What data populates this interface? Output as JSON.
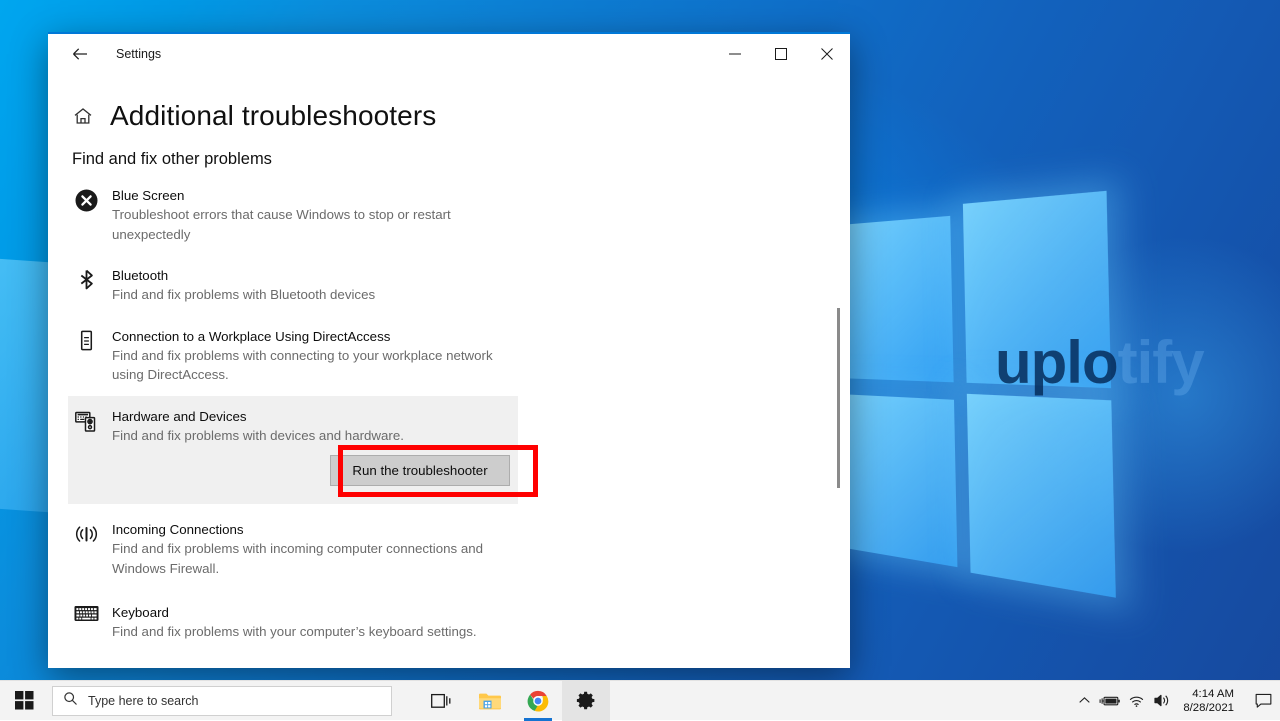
{
  "window": {
    "app_title": "Settings",
    "back_icon": "back-arrow-icon",
    "minimize_label": "—",
    "maximize_label": "□",
    "close_label": "✕",
    "page_title": "Additional troubleshooters",
    "home_icon": "home-icon",
    "section_title": "Find and fix other problems",
    "accent_color": "#0078d7",
    "selected_row_color": "#f0f0f0",
    "annotation_color": "#ff0000"
  },
  "troubleshooters": [
    {
      "icon": "blue-screen-icon",
      "title": "Blue Screen",
      "description": "Troubleshoot errors that cause Windows to stop or restart unexpectedly",
      "selected": false
    },
    {
      "icon": "bluetooth-icon",
      "title": "Bluetooth",
      "description": "Find and fix problems with Bluetooth devices",
      "selected": false
    },
    {
      "icon": "workplace-connection-icon",
      "title": "Connection to a Workplace Using DirectAccess",
      "description": "Find and fix problems with connecting to your workplace network using DirectAccess.",
      "selected": false
    },
    {
      "icon": "hardware-devices-icon",
      "title": "Hardware and Devices",
      "description": "Find and fix problems with devices and hardware.",
      "selected": true,
      "action_label": "Run the troubleshooter"
    },
    {
      "icon": "incoming-connections-icon",
      "title": "Incoming Connections",
      "description": "Find and fix problems with incoming computer connections and Windows Firewall.",
      "selected": false
    },
    {
      "icon": "keyboard-icon",
      "title": "Keyboard",
      "description": "Find and fix problems with your computer’s keyboard settings.",
      "selected": false
    }
  ],
  "desktop": {
    "watermark_primary": "uplo",
    "watermark_secondary": "tify"
  },
  "taskbar": {
    "start_icon": "windows-start-icon",
    "search_placeholder": "Type here to search",
    "search_icon": "search-icon",
    "icons": [
      {
        "name": "task-view-icon",
        "active": false,
        "highlight": false
      },
      {
        "name": "file-explorer-icon",
        "active": false,
        "highlight": false
      },
      {
        "name": "google-chrome-icon",
        "active": true,
        "highlight": false
      },
      {
        "name": "settings-gear-icon",
        "active": false,
        "highlight": true
      }
    ],
    "tray": {
      "chevron_up_icon": "show-hidden-icons-icon",
      "battery_icon": "battery-charging-icon",
      "network_icon": "wifi-icon",
      "volume_icon": "speaker-icon",
      "time": "4:14 AM",
      "date": "8/28/2021",
      "action_center_icon": "action-center-icon"
    }
  }
}
